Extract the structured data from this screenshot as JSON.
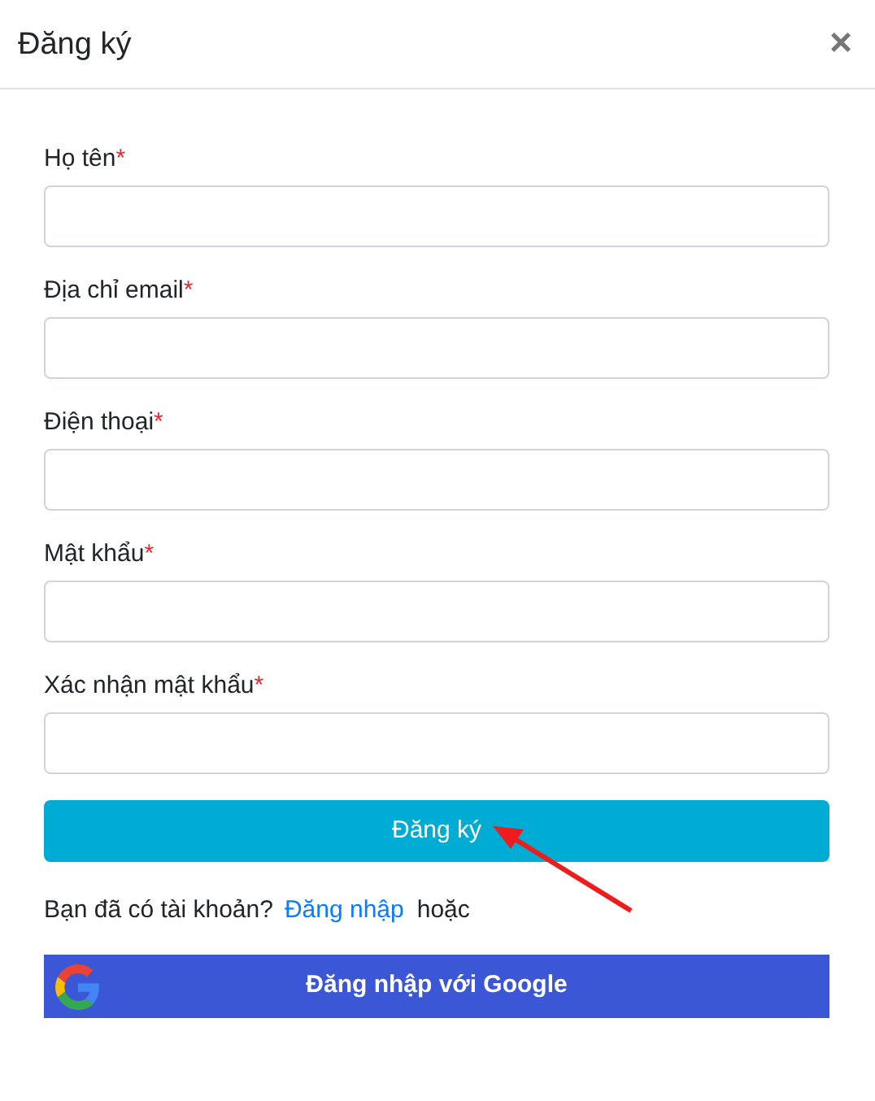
{
  "dialog": {
    "title": "Đăng ký",
    "close": "×"
  },
  "fields": [
    {
      "label": "Họ tên",
      "required_mark": "*"
    },
    {
      "label": "Địa chỉ email",
      "required_mark": "*"
    },
    {
      "label": "Điện thoại",
      "required_mark": "*"
    },
    {
      "label": "Mật khẩu",
      "required_mark": "*"
    },
    {
      "label": "Xác nhận mật khẩu",
      "required_mark": "*"
    }
  ],
  "submit_button": "Đăng ký",
  "login_prompt": {
    "question": "Bạn đã có tài khoản?",
    "link": "Đăng nhập",
    "or": "hoặc"
  },
  "google_button": "Đăng nhập với Google"
}
